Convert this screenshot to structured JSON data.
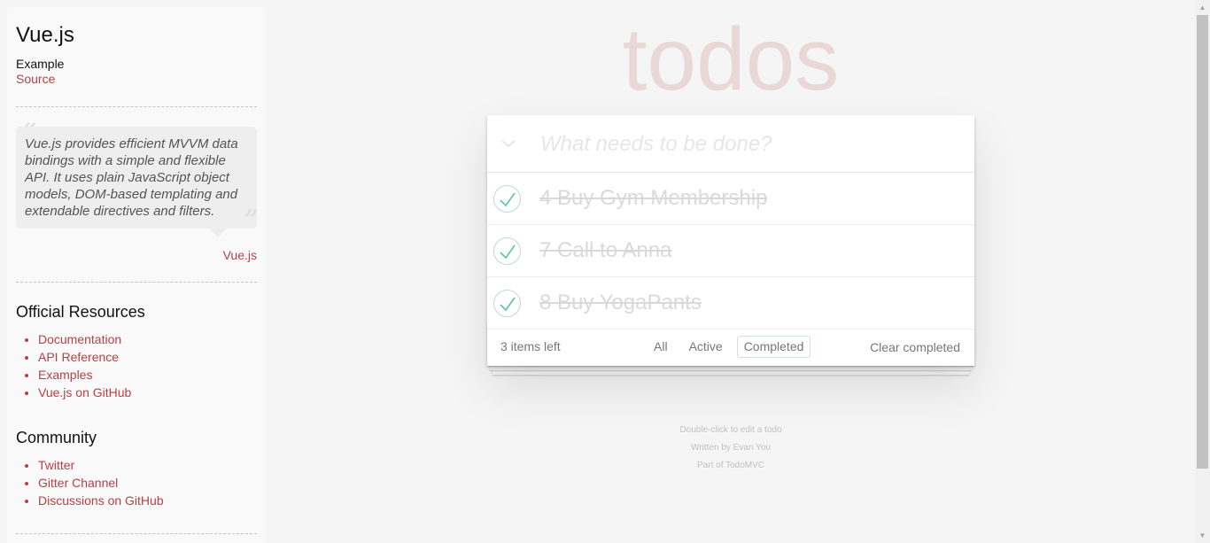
{
  "sidebar": {
    "title": "Vue.js",
    "example_label": "Example",
    "source_link": "Source",
    "quote_open": "“",
    "quote_close": "”",
    "quote": "Vue.js provides efficient MVVM data bindings with a simple and flexible API. It uses plain JavaScript object models, DOM-based templating and extendable directives and filters.",
    "quote_attribution": "Vue.js",
    "resources_heading": "Official Resources",
    "resources": [
      {
        "label": "Documentation"
      },
      {
        "label": "API Reference"
      },
      {
        "label": "Examples"
      },
      {
        "label": "Vue.js on GitHub"
      }
    ],
    "community_heading": "Community",
    "community": [
      {
        "label": "Twitter"
      },
      {
        "label": "Gitter Channel"
      },
      {
        "label": "Discussions on GitHub"
      }
    ]
  },
  "app": {
    "title": "todos",
    "toggle_all_glyph": "❯",
    "new_todo_placeholder": "What needs to be done?",
    "todos": [
      {
        "text": "4 Buy Gym Membership",
        "completed": true
      },
      {
        "text": "7 Call to Anna",
        "completed": true
      },
      {
        "text": "8 Buy YogaPants",
        "completed": true
      }
    ],
    "footer": {
      "items_left": "3 items left",
      "filters": [
        {
          "label": "All",
          "selected": false
        },
        {
          "label": "Active",
          "selected": false
        },
        {
          "label": "Completed",
          "selected": true
        }
      ],
      "clear_completed": "Clear completed"
    }
  },
  "info": {
    "line1": "Double-click to edit a todo",
    "line2": "Written by Evan You",
    "line3": "Part of TodoMVC"
  },
  "colors": {
    "accent": "#b83f45",
    "check": "#5dc2af",
    "title": "rgba(175,47,47,0.15)",
    "background": "#f5f5f5"
  },
  "icons": {
    "toggle_all": "chevron-down-icon",
    "todo_check": "checkmark-icon"
  }
}
